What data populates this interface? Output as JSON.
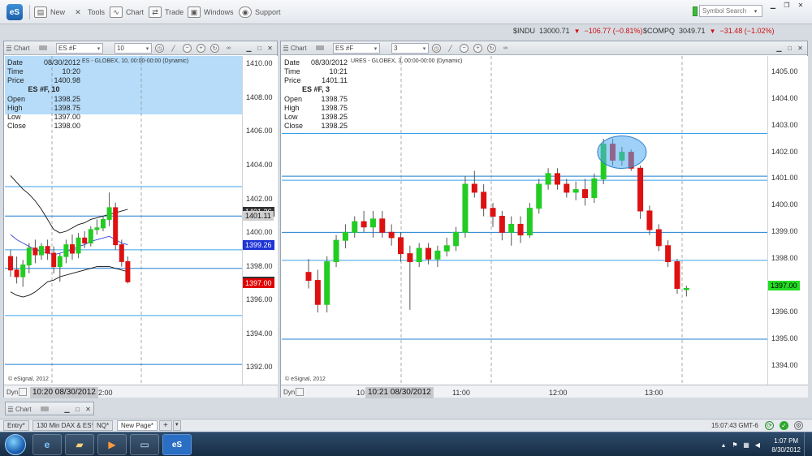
{
  "app": {
    "logo": "eS",
    "toolbar": [
      {
        "label": "New",
        "icon": "new-icon"
      },
      {
        "label": "Tools",
        "icon": "tools-icon"
      },
      {
        "label": "Chart",
        "icon": "chart-icon"
      },
      {
        "label": "Trade",
        "icon": "trade-icon"
      },
      {
        "label": "Windows",
        "icon": "windows-icon"
      },
      {
        "label": "Support",
        "icon": "support-icon"
      }
    ],
    "search_placeholder": "Symbol Search"
  },
  "tickers": [
    {
      "symbol": "$INDU",
      "price": "13000.71",
      "change": "−106.77 (−0.81%)"
    },
    {
      "symbol": "$COMPQ",
      "price": "3049.71",
      "change": "−31.48 (−1.02%)"
    }
  ],
  "colors": {
    "up": "#22cc22",
    "down": "#dd1111",
    "selection": "#b6dcfa",
    "hline": "#2f8fe0"
  },
  "charts": [
    {
      "title": "Chart",
      "symbol": "ES #F",
      "interval": "10",
      "header": "ES - GLOBEX, 10, 00:00-00:00 (Dynamic)",
      "info": {
        "date": "08/30/2012",
        "time": "10:20",
        "price": "1400.98",
        "symbol_label": "ES #F, 10",
        "open": "1398.25",
        "high": "1398.75",
        "low": "1397.00",
        "close": "1398.00"
      },
      "axis": {
        "min": 1391,
        "max": 1410.5,
        "labels": [
          "1410.00",
          "1408.00",
          "1406.00",
          "1404.00",
          "1402.00",
          "1400.00",
          "1398.00",
          "1396.00",
          "1394.00",
          "1392.00"
        ]
      },
      "tags": [
        {
          "text": "1401.26",
          "value": 1401.26,
          "bg": "#333333",
          "color": "#ffffff"
        },
        {
          "text": "1401.11",
          "value": 1401.0,
          "bg": "#cfcfcf",
          "color": "#111111"
        },
        {
          "text": "1399.26",
          "value": 1399.26,
          "bg": "#1c33d6",
          "color": "#ffffff"
        },
        {
          "text": "1397.10",
          "value": 1397.1,
          "bg": "#333333",
          "color": "#ffffff"
        },
        {
          "text": "1397.00",
          "value": 1397.0,
          "bg": "#e00000",
          "color": "#ffffff"
        }
      ],
      "copyright": "© eSignal, 2012",
      "bottom": {
        "dyn": "Dyn",
        "cursor_time": "10:20 08/30/2012",
        "after": "2:00"
      }
    },
    {
      "title": "Chart",
      "symbol": "ES #F",
      "interval": "3",
      "header": "URES - GLOBEX, 3, 00:00-00:00 (Dynamic)",
      "info": {
        "date": "08/30/2012",
        "time": "10:21",
        "price": "1401.11",
        "symbol_label": "ES #F, 3",
        "open": "1398.75",
        "high": "1398.75",
        "low": "1398.25",
        "close": "1398.25"
      },
      "axis": {
        "min": 1393.3,
        "max": 1405.6,
        "labels": [
          "1405.00",
          "1404.00",
          "1403.00",
          "1402.00",
          "1401.00",
          "1400.00",
          "1399.00",
          "1398.00",
          "1397.00",
          "1396.00",
          "1395.00",
          "1394.00"
        ]
      },
      "tags": [
        {
          "text": "1397.00",
          "value": 1397.0,
          "bg": "#22dd22",
          "color": "#000000"
        }
      ],
      "copyright": "© eSignal, 2012",
      "bottom": {
        "dyn": "Dyn",
        "before": "10",
        "cursor_time": "10:21 08/30/2012",
        "t1": "11:00",
        "t2": "12:00",
        "t3": "13:00"
      }
    }
  ],
  "mini_chart": {
    "label": "Chart"
  },
  "tabs": [
    {
      "label": "Entry*"
    },
    {
      "label": "130 Min DAX & ES*"
    },
    {
      "label": "NQ*"
    },
    {
      "label": "New Page*",
      "active": true
    }
  ],
  "status": {
    "time": "15:07:43",
    "tz": "GMT-6"
  },
  "taskbar": {
    "time": "1:07 PM",
    "date": "8/30/2012"
  },
  "chart_data": [
    {
      "type": "candlestick",
      "title": "ES #F, 10",
      "ylim": [
        1391,
        1410.5
      ],
      "hlines": [
        1402.75,
        1401.0,
        1399.0,
        1397.9,
        1395.1,
        1392.2
      ],
      "candles": [
        {
          "o": 1398.6,
          "h": 1399.0,
          "l": 1397.4,
          "c": 1397.8
        },
        {
          "o": 1397.8,
          "h": 1398.6,
          "l": 1397.0,
          "c": 1397.4
        },
        {
          "o": 1397.4,
          "h": 1398.4,
          "l": 1396.8,
          "c": 1398.1
        },
        {
          "o": 1398.1,
          "h": 1399.4,
          "l": 1397.6,
          "c": 1399.1
        },
        {
          "o": 1399.1,
          "h": 1399.6,
          "l": 1398.2,
          "c": 1398.7
        },
        {
          "o": 1398.7,
          "h": 1399.4,
          "l": 1398.4,
          "c": 1399.2
        },
        {
          "o": 1399.2,
          "h": 1399.6,
          "l": 1398.4,
          "c": 1398.8
        },
        {
          "o": 1398.8,
          "h": 1399.2,
          "l": 1397.6,
          "c": 1398.0
        },
        {
          "o": 1398.0,
          "h": 1398.8,
          "l": 1397.1,
          "c": 1398.6
        },
        {
          "o": 1398.6,
          "h": 1399.6,
          "l": 1398.2,
          "c": 1399.3
        },
        {
          "o": 1399.3,
          "h": 1399.9,
          "l": 1398.4,
          "c": 1398.8
        },
        {
          "o": 1398.8,
          "h": 1400.0,
          "l": 1398.5,
          "c": 1399.7
        },
        {
          "o": 1399.7,
          "h": 1400.1,
          "l": 1399.1,
          "c": 1399.4
        },
        {
          "o": 1399.4,
          "h": 1400.4,
          "l": 1399.2,
          "c": 1400.2
        },
        {
          "o": 1400.2,
          "h": 1400.8,
          "l": 1399.9,
          "c": 1400.3
        },
        {
          "o": 1400.3,
          "h": 1401.0,
          "l": 1400.1,
          "c": 1400.8
        },
        {
          "o": 1400.8,
          "h": 1402.4,
          "l": 1400.4,
          "c": 1401.5
        },
        {
          "o": 1401.5,
          "h": 1401.8,
          "l": 1399.0,
          "c": 1399.3
        },
        {
          "o": 1399.3,
          "h": 1399.6,
          "l": 1398.0,
          "c": 1398.3
        },
        {
          "o": 1398.3,
          "h": 1398.6,
          "l": 1397.0,
          "c": 1397.1
        }
      ],
      "bands": {
        "upper": [
          1403.4,
          1403.0,
          1402.6,
          1402.3,
          1401.9,
          1401.4,
          1400.8,
          1400.2,
          1400.0,
          1400.1,
          1400.3,
          1400.5,
          1400.6,
          1400.8,
          1400.9,
          1401.0,
          1401.1,
          1401.2,
          1401.3,
          1401.4
        ],
        "middle": [
          1399.9,
          1399.6,
          1399.4,
          1399.2,
          1399.0,
          1398.9,
          1398.8,
          1398.7,
          1398.8,
          1398.9,
          1399.0,
          1399.2,
          1399.3,
          1399.5,
          1399.6,
          1399.7,
          1399.8,
          1399.6,
          1399.4,
          1399.3
        ],
        "lower": [
          1396.5,
          1396.3,
          1396.2,
          1396.3,
          1396.5,
          1396.8,
          1397.1,
          1397.2,
          1397.4,
          1397.5,
          1397.6,
          1397.7,
          1397.8,
          1397.9,
          1398.0,
          1398.0,
          1398.0,
          1397.9,
          1397.8,
          1397.7
        ]
      }
    },
    {
      "type": "candlestick",
      "title": "ES #F, 3",
      "ylim": [
        1393.3,
        1405.6
      ],
      "hlines": [
        1402.7,
        1401.1,
        1400.95,
        1399.0,
        1397.95,
        1395.0
      ],
      "candles": [
        {
          "o": 1397.5,
          "h": 1398.0,
          "l": 1396.9,
          "c": 1397.2
        },
        {
          "o": 1397.2,
          "h": 1397.6,
          "l": 1396.0,
          "c": 1396.3
        },
        {
          "o": 1396.3,
          "h": 1398.1,
          "l": 1396.0,
          "c": 1397.9
        },
        {
          "o": 1397.9,
          "h": 1398.9,
          "l": 1397.7,
          "c": 1398.7
        },
        {
          "o": 1398.7,
          "h": 1399.3,
          "l": 1398.4,
          "c": 1399.0
        },
        {
          "o": 1399.0,
          "h": 1399.6,
          "l": 1398.8,
          "c": 1399.4
        },
        {
          "o": 1399.4,
          "h": 1399.8,
          "l": 1399.0,
          "c": 1399.2
        },
        {
          "o": 1399.2,
          "h": 1399.8,
          "l": 1398.8,
          "c": 1399.5
        },
        {
          "o": 1399.5,
          "h": 1399.8,
          "l": 1398.8,
          "c": 1399.0
        },
        {
          "o": 1399.0,
          "h": 1399.3,
          "l": 1398.5,
          "c": 1398.8
        },
        {
          "o": 1398.8,
          "h": 1399.0,
          "l": 1397.9,
          "c": 1398.2
        },
        {
          "o": 1398.2,
          "h": 1398.5,
          "l": 1396.1,
          "c": 1397.9
        },
        {
          "o": 1397.9,
          "h": 1398.6,
          "l": 1397.7,
          "c": 1398.4
        },
        {
          "o": 1398.4,
          "h": 1398.6,
          "l": 1397.8,
          "c": 1398.0
        },
        {
          "o": 1398.0,
          "h": 1398.5,
          "l": 1397.7,
          "c": 1398.3
        },
        {
          "o": 1398.3,
          "h": 1398.8,
          "l": 1398.1,
          "c": 1398.5
        },
        {
          "o": 1398.5,
          "h": 1399.2,
          "l": 1398.3,
          "c": 1399.0
        },
        {
          "o": 1399.0,
          "h": 1401.1,
          "l": 1398.8,
          "c": 1400.8
        },
        {
          "o": 1400.8,
          "h": 1401.3,
          "l": 1400.3,
          "c": 1400.5
        },
        {
          "o": 1400.5,
          "h": 1400.8,
          "l": 1399.6,
          "c": 1399.9
        },
        {
          "o": 1399.9,
          "h": 1400.1,
          "l": 1399.2,
          "c": 1399.6
        },
        {
          "o": 1399.6,
          "h": 1399.8,
          "l": 1398.7,
          "c": 1399.0
        },
        {
          "o": 1399.0,
          "h": 1399.6,
          "l": 1398.5,
          "c": 1399.3
        },
        {
          "o": 1399.3,
          "h": 1399.6,
          "l": 1398.6,
          "c": 1398.9
        },
        {
          "o": 1398.9,
          "h": 1400.1,
          "l": 1398.8,
          "c": 1399.9
        },
        {
          "o": 1399.9,
          "h": 1401.0,
          "l": 1399.7,
          "c": 1400.8
        },
        {
          "o": 1400.8,
          "h": 1401.4,
          "l": 1400.6,
          "c": 1401.2
        },
        {
          "o": 1401.2,
          "h": 1401.4,
          "l": 1400.6,
          "c": 1400.8
        },
        {
          "o": 1400.8,
          "h": 1401.0,
          "l": 1400.3,
          "c": 1400.5
        },
        {
          "o": 1400.5,
          "h": 1400.9,
          "l": 1400.2,
          "c": 1400.6
        },
        {
          "o": 1400.6,
          "h": 1401.0,
          "l": 1400.0,
          "c": 1400.3
        },
        {
          "o": 1400.3,
          "h": 1401.2,
          "l": 1400.1,
          "c": 1401.0
        },
        {
          "o": 1401.0,
          "h": 1402.5,
          "l": 1400.8,
          "c": 1402.3
        },
        {
          "o": 1402.3,
          "h": 1402.5,
          "l": 1401.5,
          "c": 1401.7
        },
        {
          "o": 1401.7,
          "h": 1402.2,
          "l": 1401.5,
          "c": 1402.0
        },
        {
          "o": 1402.0,
          "h": 1402.1,
          "l": 1401.3,
          "c": 1401.4
        },
        {
          "o": 1401.4,
          "h": 1401.5,
          "l": 1399.5,
          "c": 1399.8
        },
        {
          "o": 1399.8,
          "h": 1400.0,
          "l": 1398.9,
          "c": 1399.1
        },
        {
          "o": 1399.1,
          "h": 1399.3,
          "l": 1398.3,
          "c": 1398.5
        },
        {
          "o": 1398.5,
          "h": 1398.7,
          "l": 1397.7,
          "c": 1397.9
        },
        {
          "o": 1397.9,
          "h": 1398.0,
          "l": 1396.7,
          "c": 1396.9
        },
        {
          "o": 1396.9,
          "h": 1397.0,
          "l": 1396.6,
          "c": 1396.9
        }
      ],
      "highlight_circle": {
        "x_index": 34,
        "y": 1402.0
      }
    }
  ]
}
